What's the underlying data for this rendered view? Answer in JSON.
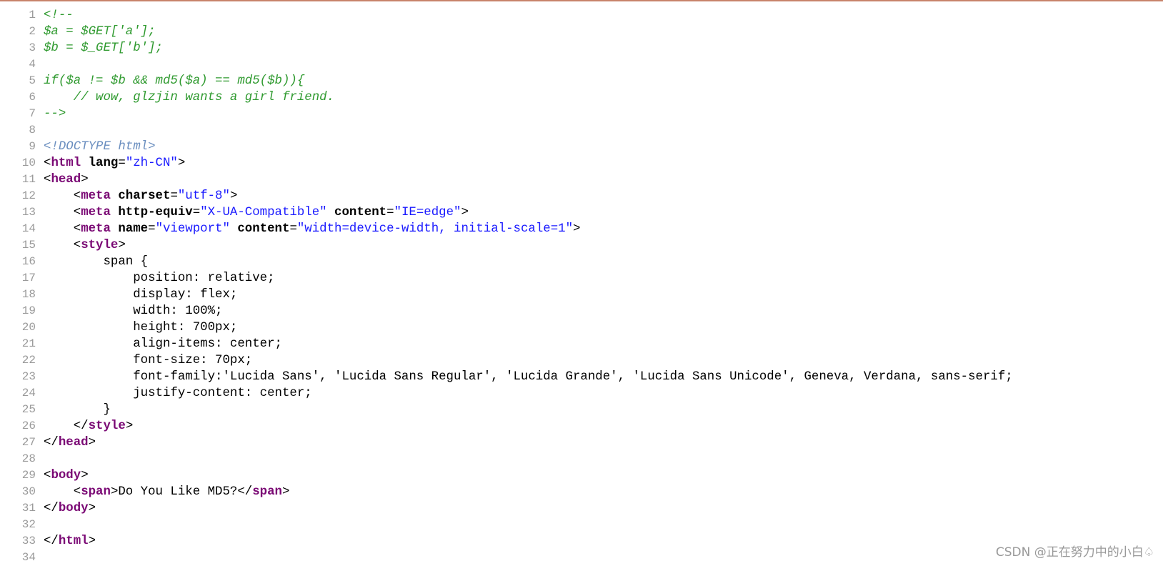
{
  "colors": {
    "top_border": "#c8836a",
    "comment": "#2f9a2f",
    "doctype": "#6a8ebf",
    "tag": "#7a0874",
    "attribute": "#000000",
    "value": "#1a1aff",
    "line_number": "#9a9a9a",
    "watermark": "#999999"
  },
  "code_lines": [
    {
      "n": "1",
      "tokens": [
        {
          "t": "<!--",
          "k": "comment"
        }
      ]
    },
    {
      "n": "2",
      "tokens": [
        {
          "t": "$a = $GET['a'];",
          "k": "comment"
        }
      ]
    },
    {
      "n": "3",
      "tokens": [
        {
          "t": "$b = $_GET['b'];",
          "k": "comment"
        }
      ]
    },
    {
      "n": "4",
      "tokens": []
    },
    {
      "n": "5",
      "tokens": [
        {
          "t": "if($a != $b && md5($a) == md5($b)){",
          "k": "comment"
        }
      ]
    },
    {
      "n": "6",
      "tokens": [
        {
          "t": "    // wow, glzjin wants a girl friend.",
          "k": "comment"
        }
      ]
    },
    {
      "n": "7",
      "tokens": [
        {
          "t": "-->",
          "k": "comment"
        }
      ]
    },
    {
      "n": "8",
      "tokens": []
    },
    {
      "n": "9",
      "tokens": [
        {
          "t": "<!DOCTYPE html>",
          "k": "doctype"
        }
      ]
    },
    {
      "n": "10",
      "tokens": [
        {
          "t": "<",
          "k": "punct"
        },
        {
          "t": "html",
          "k": "tag"
        },
        {
          "t": " lang",
          "k": "attr"
        },
        {
          "t": "=",
          "k": "punct"
        },
        {
          "t": "\"zh-CN\"",
          "k": "value"
        },
        {
          "t": ">",
          "k": "punct"
        }
      ]
    },
    {
      "n": "11",
      "tokens": [
        {
          "t": "<",
          "k": "punct"
        },
        {
          "t": "head",
          "k": "tag"
        },
        {
          "t": ">",
          "k": "punct"
        }
      ]
    },
    {
      "n": "12",
      "tokens": [
        {
          "t": "    <",
          "k": "punct"
        },
        {
          "t": "meta",
          "k": "tag"
        },
        {
          "t": " charset",
          "k": "attr"
        },
        {
          "t": "=",
          "k": "punct"
        },
        {
          "t": "\"utf-8\"",
          "k": "value"
        },
        {
          "t": ">",
          "k": "punct"
        }
      ]
    },
    {
      "n": "13",
      "tokens": [
        {
          "t": "    <",
          "k": "punct"
        },
        {
          "t": "meta",
          "k": "tag"
        },
        {
          "t": " http-equiv",
          "k": "attr"
        },
        {
          "t": "=",
          "k": "punct"
        },
        {
          "t": "\"X-UA-Compatible\"",
          "k": "value"
        },
        {
          "t": " content",
          "k": "attr"
        },
        {
          "t": "=",
          "k": "punct"
        },
        {
          "t": "\"IE=edge\"",
          "k": "value"
        },
        {
          "t": ">",
          "k": "punct"
        }
      ]
    },
    {
      "n": "14",
      "tokens": [
        {
          "t": "    <",
          "k": "punct"
        },
        {
          "t": "meta",
          "k": "tag"
        },
        {
          "t": " name",
          "k": "attr"
        },
        {
          "t": "=",
          "k": "punct"
        },
        {
          "t": "\"viewport\"",
          "k": "value"
        },
        {
          "t": " content",
          "k": "attr"
        },
        {
          "t": "=",
          "k": "punct"
        },
        {
          "t": "\"width=device-width, initial-scale=1\"",
          "k": "value"
        },
        {
          "t": ">",
          "k": "punct"
        }
      ]
    },
    {
      "n": "15",
      "tokens": [
        {
          "t": "    <",
          "k": "punct"
        },
        {
          "t": "style",
          "k": "tag"
        },
        {
          "t": ">",
          "k": "punct"
        }
      ]
    },
    {
      "n": "16",
      "tokens": [
        {
          "t": "        span {",
          "k": "plain"
        }
      ]
    },
    {
      "n": "17",
      "tokens": [
        {
          "t": "            position: relative;",
          "k": "plain"
        }
      ]
    },
    {
      "n": "18",
      "tokens": [
        {
          "t": "            display: flex;",
          "k": "plain"
        }
      ]
    },
    {
      "n": "19",
      "tokens": [
        {
          "t": "            width: 100%;",
          "k": "plain"
        }
      ]
    },
    {
      "n": "20",
      "tokens": [
        {
          "t": "            height: 700px;",
          "k": "plain"
        }
      ]
    },
    {
      "n": "21",
      "tokens": [
        {
          "t": "            align-items: center;",
          "k": "plain"
        }
      ]
    },
    {
      "n": "22",
      "tokens": [
        {
          "t": "            font-size: 70px;",
          "k": "plain"
        }
      ]
    },
    {
      "n": "23",
      "tokens": [
        {
          "t": "            font-family:'Lucida Sans', 'Lucida Sans Regular', 'Lucida Grande', 'Lucida Sans Unicode', Geneva, Verdana, sans-serif;",
          "k": "plain"
        }
      ]
    },
    {
      "n": "24",
      "tokens": [
        {
          "t": "            justify-content: center;",
          "k": "plain"
        }
      ]
    },
    {
      "n": "25",
      "tokens": [
        {
          "t": "        }",
          "k": "plain"
        }
      ]
    },
    {
      "n": "26",
      "tokens": [
        {
          "t": "    </",
          "k": "punct"
        },
        {
          "t": "style",
          "k": "tag"
        },
        {
          "t": ">",
          "k": "punct"
        }
      ]
    },
    {
      "n": "27",
      "tokens": [
        {
          "t": "</",
          "k": "punct"
        },
        {
          "t": "head",
          "k": "tag"
        },
        {
          "t": ">",
          "k": "punct"
        }
      ]
    },
    {
      "n": "28",
      "tokens": []
    },
    {
      "n": "29",
      "tokens": [
        {
          "t": "<",
          "k": "punct"
        },
        {
          "t": "body",
          "k": "tag"
        },
        {
          "t": ">",
          "k": "punct"
        }
      ]
    },
    {
      "n": "30",
      "tokens": [
        {
          "t": "    <",
          "k": "punct"
        },
        {
          "t": "span",
          "k": "tag"
        },
        {
          "t": ">",
          "k": "punct"
        },
        {
          "t": "Do You Like MD5?",
          "k": "plain"
        },
        {
          "t": "</",
          "k": "punct"
        },
        {
          "t": "span",
          "k": "tag"
        },
        {
          "t": ">",
          "k": "punct"
        }
      ]
    },
    {
      "n": "31",
      "tokens": [
        {
          "t": "</",
          "k": "punct"
        },
        {
          "t": "body",
          "k": "tag"
        },
        {
          "t": ">",
          "k": "punct"
        }
      ]
    },
    {
      "n": "32",
      "tokens": []
    },
    {
      "n": "33",
      "tokens": [
        {
          "t": "</",
          "k": "punct"
        },
        {
          "t": "html",
          "k": "tag"
        },
        {
          "t": ">",
          "k": "punct"
        }
      ]
    },
    {
      "n": "34",
      "tokens": []
    }
  ],
  "watermark": "CSDN @正在努力中的小白♤"
}
